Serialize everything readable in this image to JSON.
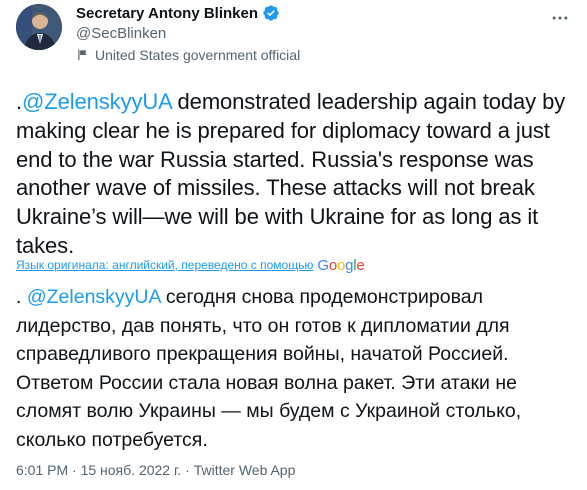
{
  "author": {
    "name": "Secretary Antony Blinken",
    "handle": "@SecBlinken",
    "affiliation": "United States government official"
  },
  "tweet": {
    "en_prefix": ".",
    "en_mention": "@ZelenskyyUA",
    "en_text": " demonstrated leadership again today by making clear he is prepared for diplomacy toward a just end to the war Russia started. Russia's response was another wave of missiles. These attacks will not break Ukraine’s will—we will be with Ukraine for as long as it takes.",
    "translation_note": "Язык оригинала: английский, переведено с помощью",
    "translator_brand": "Google",
    "ru_prefix": ". ",
    "ru_mention": "@ZelenskyyUA",
    "ru_text": " сегодня снова продемонстрировал лидерство, дав понять, что он готов к дипломатии для справедливого прекращения войны, начатой Россией. Ответом России стала новая волна ракет. Эти атаки не сломят волю Украины — мы будем с Украиной столько, сколько потребуется.",
    "timestamp": "6:01 PM · 15 нояб. 2022 г. · Twitter Web App"
  },
  "colors": {
    "text": "#0f1419",
    "secondary": "#536471",
    "link": "#1d9bf0"
  },
  "icons": [
    "verified-badge-icon",
    "flag-icon",
    "more-options-icon"
  ]
}
